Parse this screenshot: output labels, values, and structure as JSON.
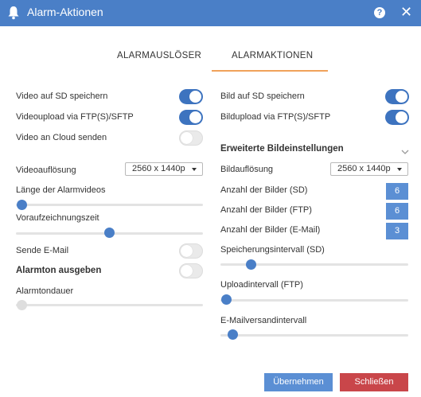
{
  "dialog": {
    "title": "Alarm-Aktionen"
  },
  "tabs": [
    {
      "label": "ALARMAUSLÖSER",
      "active": false
    },
    {
      "label": "ALARMAKTIONEN",
      "active": true
    }
  ],
  "left": {
    "video_sd": {
      "label": "Video auf SD speichern",
      "on": true
    },
    "video_ftp": {
      "label": "Videoupload via FTP(S)/SFTP",
      "on": true
    },
    "video_cloud": {
      "label": "Video an Cloud senden",
      "on": false
    },
    "video_resolution": {
      "label": "Videoauflösung",
      "value": "2560 x 1440p"
    },
    "video_length": {
      "label": "Länge der Alarmvideos",
      "level": 0
    },
    "prerecord": {
      "label": "Voraufzeichnungszeit",
      "level": 0.5
    },
    "email": {
      "label": "Sende E-Mail",
      "on": false
    },
    "alarm_tone": {
      "label": "Alarmton ausgeben",
      "on": false
    },
    "tone_duration": {
      "label": "Alarmtondauer",
      "level": 0
    }
  },
  "right": {
    "image_sd": {
      "label": "Bild auf SD speichern",
      "on": true
    },
    "image_ftp": {
      "label": "Bildupload via FTP(S)/SFTP",
      "on": true
    },
    "advanced": {
      "label": "Erweiterte Bildeinstellungen"
    },
    "image_resolution": {
      "label": "Bildauflösung",
      "value": "2560 x 1440p"
    },
    "count_sd": {
      "label": "Anzahl der Bilder (SD)",
      "value": "6"
    },
    "count_ftp": {
      "label": "Anzahl der Bilder (FTP)",
      "value": "6"
    },
    "count_email": {
      "label": "Anzahl der Bilder (E-Mail)",
      "value": "3"
    },
    "save_interval": {
      "label": "Speicherungsintervall (SD)",
      "level": 0.15
    },
    "upload_interval": {
      "label": "Uploadintervall (FTP)",
      "level": 0
    },
    "mail_interval": {
      "label": "E-Mailversandintervall",
      "level": 0.04
    }
  },
  "footer": {
    "apply_label": "Übernehmen",
    "close_label": "Schließen"
  },
  "colors": {
    "header": "#4a7fc7",
    "accent": "#3d73bf",
    "tab_underline": "#f0a25b",
    "close": "#c9464a"
  },
  "icons": {
    "title": "bell-icon",
    "help": "help-icon",
    "close": "close-icon",
    "expand": "chevron-down-icon"
  }
}
